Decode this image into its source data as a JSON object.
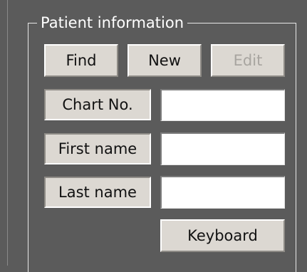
{
  "group_box": {
    "title": "Patient information"
  },
  "actions": {
    "find_label": "Find",
    "new_label": "New",
    "edit_label": "Edit"
  },
  "fields": {
    "chart_no": {
      "label": "Chart No.",
      "value": ""
    },
    "first_name": {
      "label": "First name",
      "value": ""
    },
    "last_name": {
      "label": "Last name",
      "value": ""
    }
  },
  "keyboard_label": "Keyboard",
  "colors": {
    "background": "#5b5b5b",
    "control_face": "#dcd8d2",
    "disabled_text": "#a8a5a0",
    "group_border": "#e8e8e8"
  }
}
